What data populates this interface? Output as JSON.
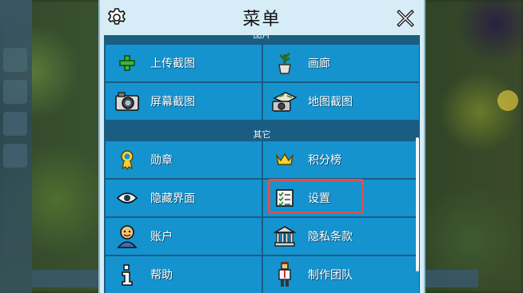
{
  "dialog": {
    "title": "菜单"
  },
  "sections": {
    "pictures_label": "图片",
    "other_label": "其它"
  },
  "items": {
    "upload_screenshot": "上传截图",
    "gallery": "画廊",
    "screen_screenshot": "屏幕截图",
    "map_screenshot": "地图截图",
    "achievements": "勋章",
    "leaderboard": "积分榜",
    "hide_ui": "隐藏界面",
    "settings": "设置",
    "account": "账户",
    "privacy": "隐私条款",
    "help": "帮助",
    "credits": "制作团队"
  },
  "icons": {
    "gear": "gear-icon",
    "close": "close-icon",
    "upload": "plus-icon",
    "gallery": "plant-pot-icon",
    "screen": "camera-icon",
    "map": "map-camera-icon",
    "achievements": "medal-icon",
    "leaderboard": "crown-icon",
    "hide_ui": "eye-icon",
    "settings": "checklist-icon",
    "account": "user-icon",
    "privacy": "building-icon",
    "help": "info-icon",
    "credits": "person-icon"
  },
  "colors": {
    "panel_bg": "#1b5c82",
    "cell_bg": "#1493cf",
    "dialog_bg": "#d6ecf6",
    "highlight": "#d9534f"
  }
}
